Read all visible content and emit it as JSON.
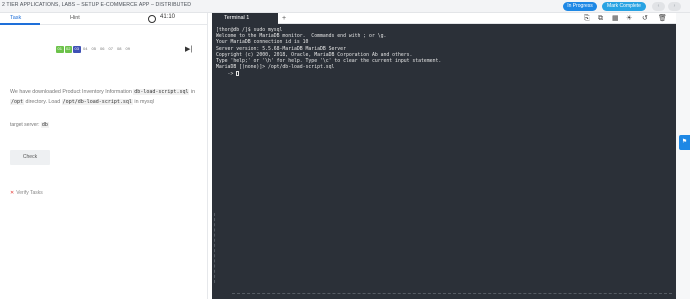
{
  "header": {
    "breadcrumb": "2 TIER APPLICATIONS, LABS – SETUP E-COMMERCE APP – DISTRIBUTED",
    "status": "In Progress",
    "mark_complete": "Mark Complete",
    "prev": "‹",
    "next": "›"
  },
  "left": {
    "tabs": [
      "Task",
      "Hint"
    ],
    "timer": "41:10",
    "steps": [
      "01",
      "02",
      "03",
      "04",
      "05",
      "06",
      "07",
      "08",
      "09"
    ],
    "task_intro": "We have downloaded Product Inventory Information",
    "task_code1": "db-load-script.sql",
    "task_in": "in",
    "task_code2": "/opt",
    "task_mid": "directory. Load",
    "task_code3": "/opt/db-load-script.sql",
    "task_end": "in mysql",
    "target_label": "target server:",
    "target_value": "db",
    "check_label": "Check",
    "verify_label": "Verify Tasks"
  },
  "terminal": {
    "tab_label": "Terminal 1",
    "add_label": "+",
    "lines": [
      "[thor@db /]$ sudo mysql",
      "Welcome to the MariaDB monitor.  Commands end with ; or \\g.",
      "Your MariaDB connection id is 10",
      "Server version: 5.5.68-MariaDB MariaDB Server",
      "",
      "Copyright (c) 2000, 2018, Oracle, MariaDB Corporation Ab and others.",
      "",
      "Type 'help;' or '\\h' for help. Type '\\c' to clear the current input statement.",
      "",
      "MariaDB [(none)]> /opt/db-load-script.sql",
      "    -> "
    ]
  },
  "icons": [
    "timer-icon",
    "skip-icon",
    "copy-icon",
    "external-icon",
    "grid-icon",
    "brightness-icon",
    "history-icon",
    "delete-icon",
    "help-icon"
  ]
}
